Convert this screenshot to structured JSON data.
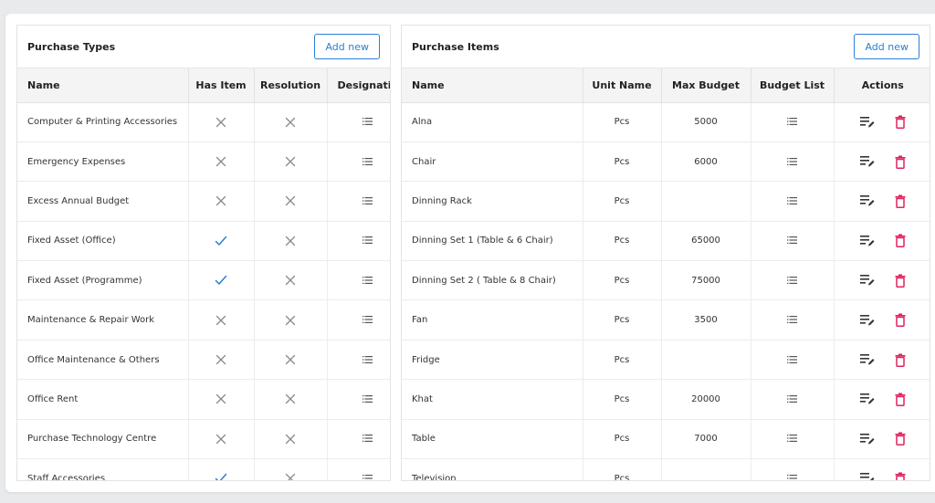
{
  "purchase_types": {
    "title": "Purchase Types",
    "add_label": "Add new",
    "columns": [
      "Name",
      "Has Item",
      "Resolution",
      "Designatio"
    ],
    "rows": [
      {
        "name": "Computer & Printing Accessories",
        "has_item": false,
        "resolution": false
      },
      {
        "name": "Emergency Expenses",
        "has_item": false,
        "resolution": false
      },
      {
        "name": "Excess Annual Budget",
        "has_item": false,
        "resolution": false
      },
      {
        "name": "Fixed Asset (Office)",
        "has_item": true,
        "resolution": false
      },
      {
        "name": "Fixed Asset (Programme)",
        "has_item": true,
        "resolution": false
      },
      {
        "name": "Maintenance & Repair Work",
        "has_item": false,
        "resolution": false
      },
      {
        "name": "Office Maintenance & Others",
        "has_item": false,
        "resolution": false
      },
      {
        "name": "Office Rent",
        "has_item": false,
        "resolution": false
      },
      {
        "name": "Purchase Technology Centre",
        "has_item": false,
        "resolution": false
      },
      {
        "name": "Staff Accessories",
        "has_item": true,
        "resolution": false
      }
    ]
  },
  "purchase_items": {
    "title": "Purchase Items",
    "add_label": "Add new",
    "columns": [
      "Name",
      "Unit Name",
      "Max Budget",
      "Budget List",
      "Actions"
    ],
    "rows": [
      {
        "name": "Alna",
        "unit": "Pcs",
        "max_budget": "5000"
      },
      {
        "name": "Chair",
        "unit": "Pcs",
        "max_budget": "6000"
      },
      {
        "name": "Dinning Rack",
        "unit": "Pcs",
        "max_budget": ""
      },
      {
        "name": "Dinning Set 1 (Table & 6 Chair)",
        "unit": "Pcs",
        "max_budget": "65000"
      },
      {
        "name": "Dinning Set 2 ( Table & 8 Chair)",
        "unit": "Pcs",
        "max_budget": "75000"
      },
      {
        "name": "Fan",
        "unit": "Pcs",
        "max_budget": "3500"
      },
      {
        "name": "Fridge",
        "unit": "Pcs",
        "max_budget": ""
      },
      {
        "name": "Khat",
        "unit": "Pcs",
        "max_budget": "20000"
      },
      {
        "name": "Table",
        "unit": "Pcs",
        "max_budget": "7000"
      },
      {
        "name": "Television",
        "unit": "Pcs",
        "max_budget": ""
      }
    ]
  },
  "icons": {
    "check": "check-icon",
    "cross": "close-icon",
    "list": "list-icon",
    "edit": "edit-list-icon",
    "delete": "trash-icon"
  },
  "colors": {
    "accent": "#2a7fd4",
    "check": "#2a7fd4",
    "cross": "#8a8a8a",
    "delete": "#e0245e"
  }
}
